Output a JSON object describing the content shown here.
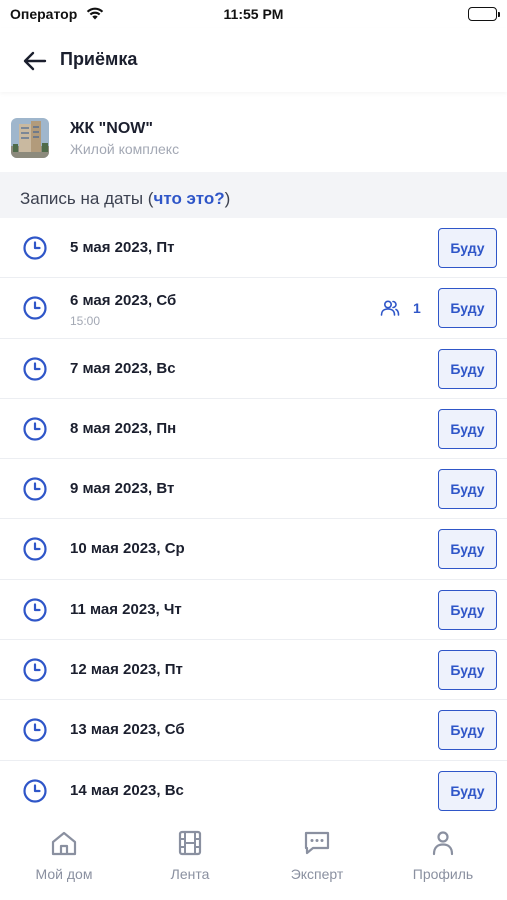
{
  "status_bar": {
    "carrier": "Оператор",
    "time": "11:55 PM"
  },
  "header": {
    "title": "Приёмка"
  },
  "complex": {
    "name": "ЖК \"NOW\"",
    "type": "Жилой комплекс"
  },
  "dates_section": {
    "prefix": "Запись на даты (",
    "link": "что это?",
    "suffix": ")"
  },
  "button_label": "Буду",
  "dates": [
    {
      "date": "5 мая 2023, Пт"
    },
    {
      "date": "6 мая 2023, Сб",
      "time": "15:00",
      "attendees": "1"
    },
    {
      "date": "7 мая 2023, Вс"
    },
    {
      "date": "8 мая 2023, Пн"
    },
    {
      "date": "9 мая 2023, Вт"
    },
    {
      "date": "10 мая 2023, Ср"
    },
    {
      "date": "11 мая 2023, Чт"
    },
    {
      "date": "12 мая 2023, Пт"
    },
    {
      "date": "13 мая 2023, Сб"
    },
    {
      "date": "14 мая 2023, Вс"
    }
  ],
  "tabs": [
    {
      "label": "Мой дом",
      "icon": "home-icon"
    },
    {
      "label": "Лента",
      "icon": "film-icon"
    },
    {
      "label": "Эксперт",
      "icon": "chat-icon"
    },
    {
      "label": "Профиль",
      "icon": "profile-icon"
    }
  ],
  "colors": {
    "accent": "#2f56c8",
    "button_bg": "#eef2fc",
    "muted": "#a3a8b4",
    "section_bg": "#f3f4f7"
  }
}
